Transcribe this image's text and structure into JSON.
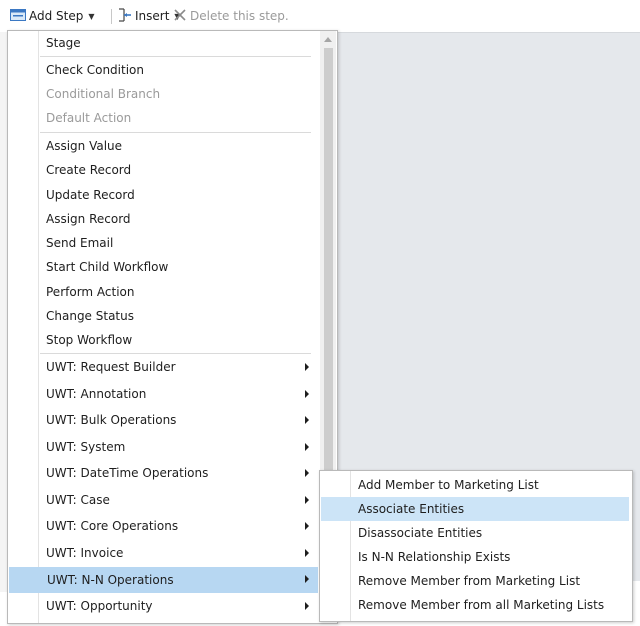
{
  "toolbar": {
    "add_step_label": "Add Step",
    "insert_label": "Insert",
    "delete_label": "Delete this step."
  },
  "menu": {
    "items": [
      "Stage",
      "Check Condition",
      "Conditional Branch",
      "Default Action",
      "Assign Value",
      "Create Record",
      "Update Record",
      "Assign Record",
      "Send Email",
      "Start Child Workflow",
      "Perform Action",
      "Change Status",
      "Stop Workflow",
      "UWT: Request Builder",
      "UWT: Annotation",
      "UWT: Bulk Operations",
      "UWT: System",
      "UWT: DateTime Operations",
      "UWT: Case",
      "UWT: Core Operations",
      "UWT: Invoice",
      "UWT: N-N Operations",
      "UWT: Opportunity"
    ],
    "highlight_color": "#b7d7f2"
  },
  "submenu": {
    "items": [
      "Add Member to Marketing List",
      "Associate Entities",
      "Disassociate Entities",
      "Is N-N Relationship Exists",
      "Remove Member from Marketing List",
      "Remove Member from all Marketing Lists"
    ],
    "highlight_color": "#cce4f7"
  },
  "icons": {
    "add_step": "add-step-icon",
    "insert": "insert-icon",
    "delete": "delete-x-icon"
  }
}
